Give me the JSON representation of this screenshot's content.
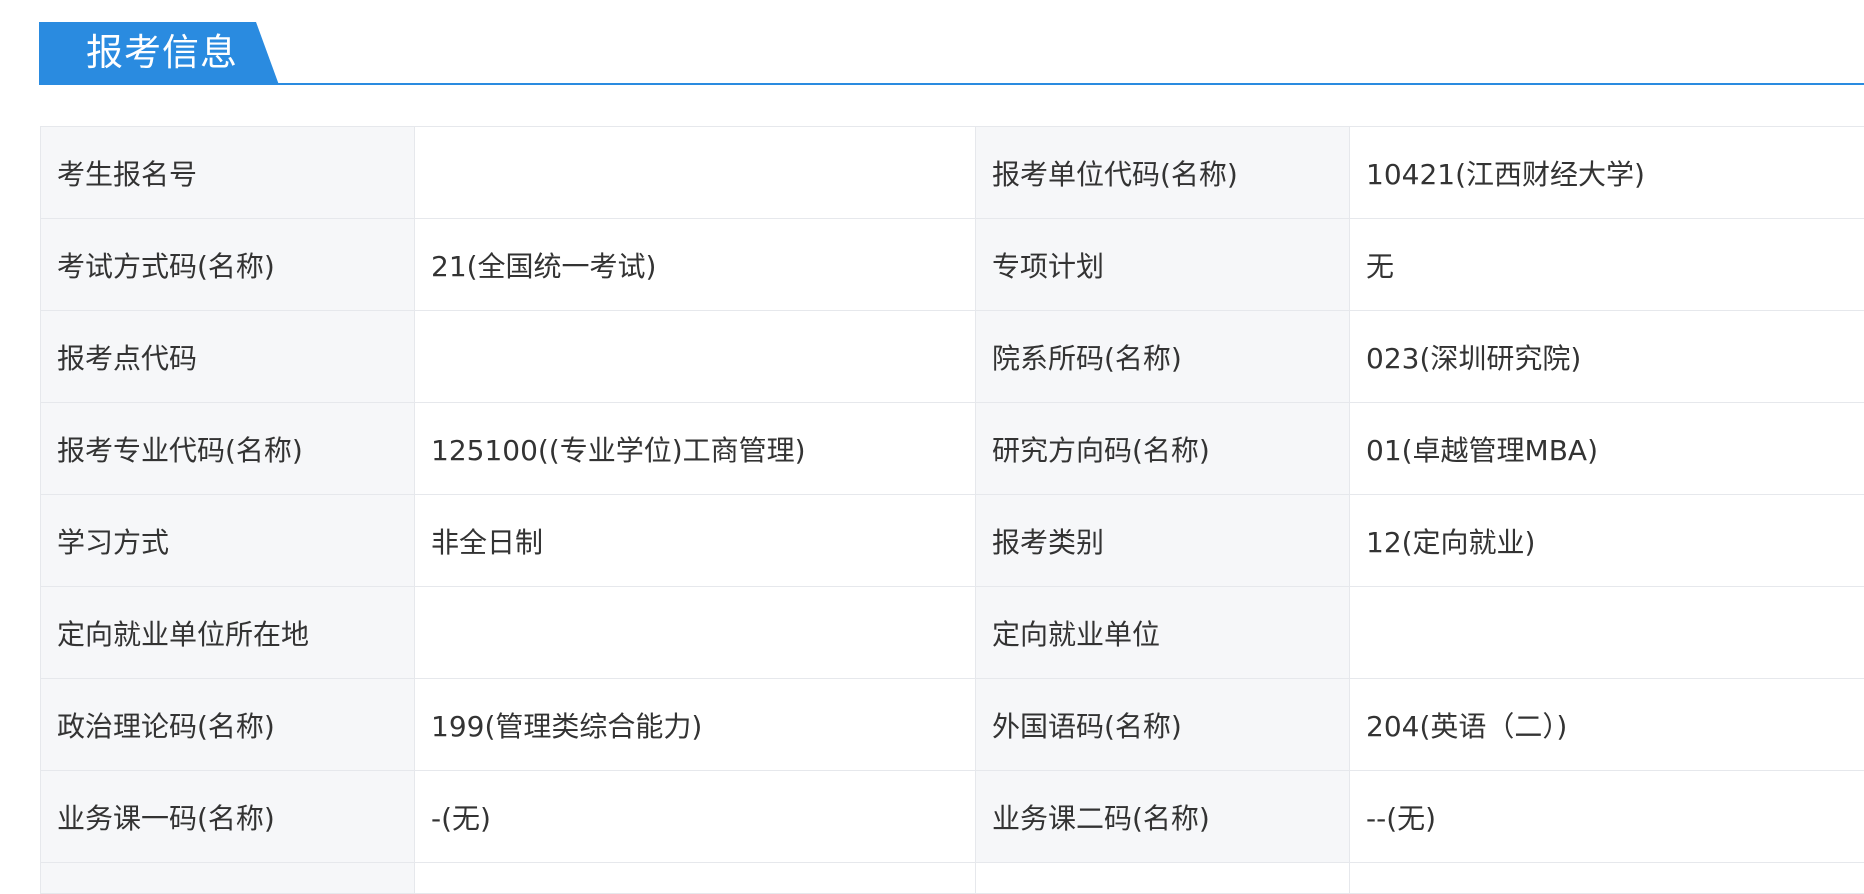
{
  "section": {
    "title": "报考信息"
  },
  "rows": [
    {
      "label_left": "考生报名号",
      "value_left": "",
      "label_right": "报考单位代码(名称)",
      "value_right": "10421(江西财经大学)"
    },
    {
      "label_left": "考试方式码(名称)",
      "value_left": "21(全国统一考试)",
      "label_right": "专项计划",
      "value_right": "无"
    },
    {
      "label_left": "报考点代码",
      "value_left": "",
      "label_right": "院系所码(名称)",
      "value_right": "023(深圳研究院)"
    },
    {
      "label_left": "报考专业代码(名称)",
      "value_left": "125100((专业学位)工商管理)",
      "label_right": "研究方向码(名称)",
      "value_right": "01(卓越管理MBA)"
    },
    {
      "label_left": "学习方式",
      "value_left": "非全日制",
      "label_right": "报考类别",
      "value_right": "12(定向就业)"
    },
    {
      "label_left": "定向就业单位所在地",
      "value_left": "",
      "label_right": "定向就业单位",
      "value_right": ""
    },
    {
      "label_left": "政治理论码(名称)",
      "value_left": "199(管理类综合能力)",
      "label_right": "外国语码(名称)",
      "value_right": "204(英语（二）)"
    },
    {
      "label_left": "业务课一码(名称)",
      "value_left": "-(无)",
      "label_right": "业务课二码(名称)",
      "value_right": "--(无)"
    }
  ],
  "colors": {
    "accent": "#2a8be0",
    "label_bg": "#f6f7f9",
    "border": "#e6e8ec",
    "text": "#333333"
  }
}
